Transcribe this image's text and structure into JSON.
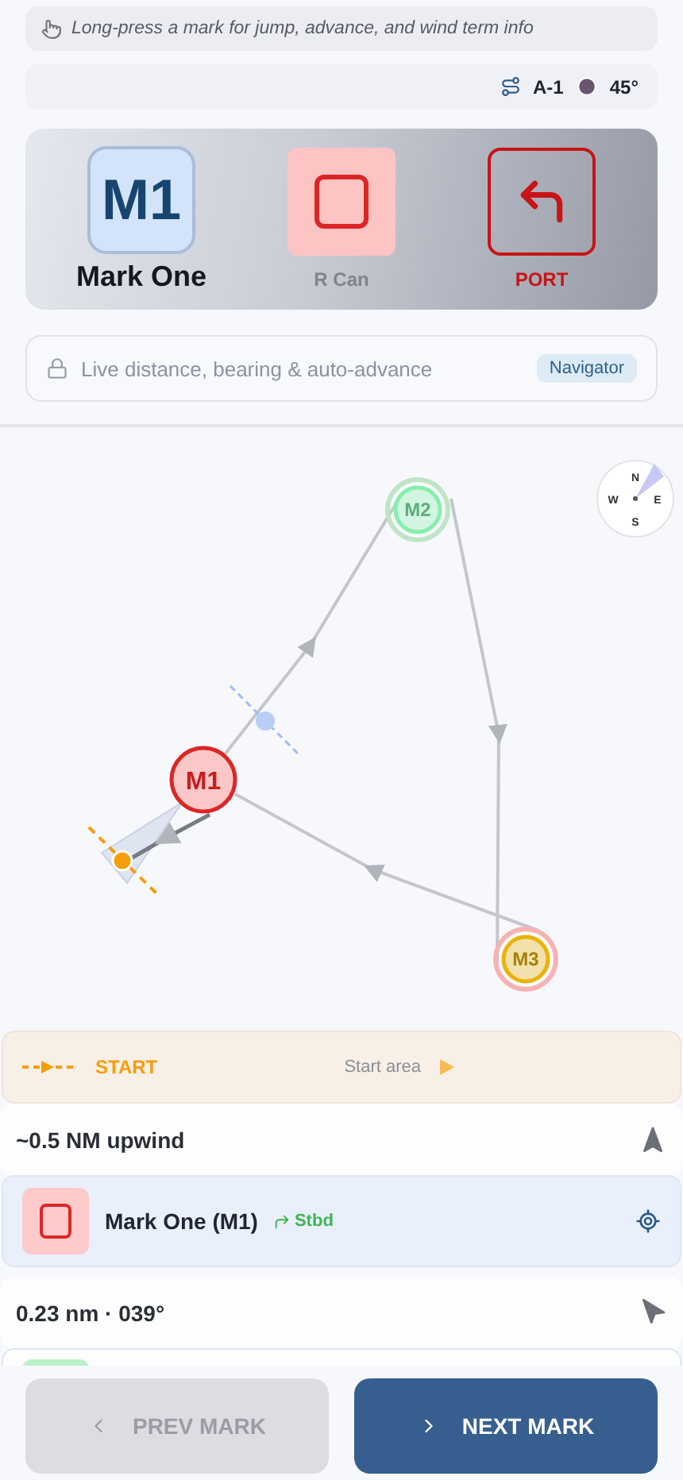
{
  "hint": "Long-press a mark for jump, advance, and wind term info",
  "info": {
    "course": "A-1",
    "wind": "45°"
  },
  "hero": {
    "code": "M1",
    "name": "Mark One",
    "type": "R Can",
    "rounding": "PORT"
  },
  "locked": {
    "text": "Live distance, bearing & auto-advance",
    "badge": "Navigator"
  },
  "map": {
    "compass": [
      "N",
      "E",
      "S",
      "W"
    ],
    "marks": [
      {
        "label": "M1",
        "color": "#dc2626",
        "current": true
      },
      {
        "label": "M2",
        "color": "#86efac",
        "current": false
      },
      {
        "label": "M3",
        "color": "#eab308",
        "current": false
      }
    ]
  },
  "start": {
    "label": "START",
    "note": "Start area"
  },
  "rows": [
    {
      "kind": "upwind",
      "text": "~0.5 NM upwind"
    },
    {
      "kind": "mark",
      "color": "#fecaca",
      "name": "Mark One (M1)",
      "rounding": "Stbd",
      "selected": true
    },
    {
      "kind": "bearing",
      "text": "0.23 nm · 039°"
    },
    {
      "kind": "mark",
      "color": "#bbf0c8",
      "selected": false
    }
  ],
  "buttons": [
    {
      "label": "PREV MARK",
      "kind": "prev",
      "disabled": true
    },
    {
      "label": "NEXT MARK",
      "kind": "next",
      "disabled": false
    }
  ]
}
